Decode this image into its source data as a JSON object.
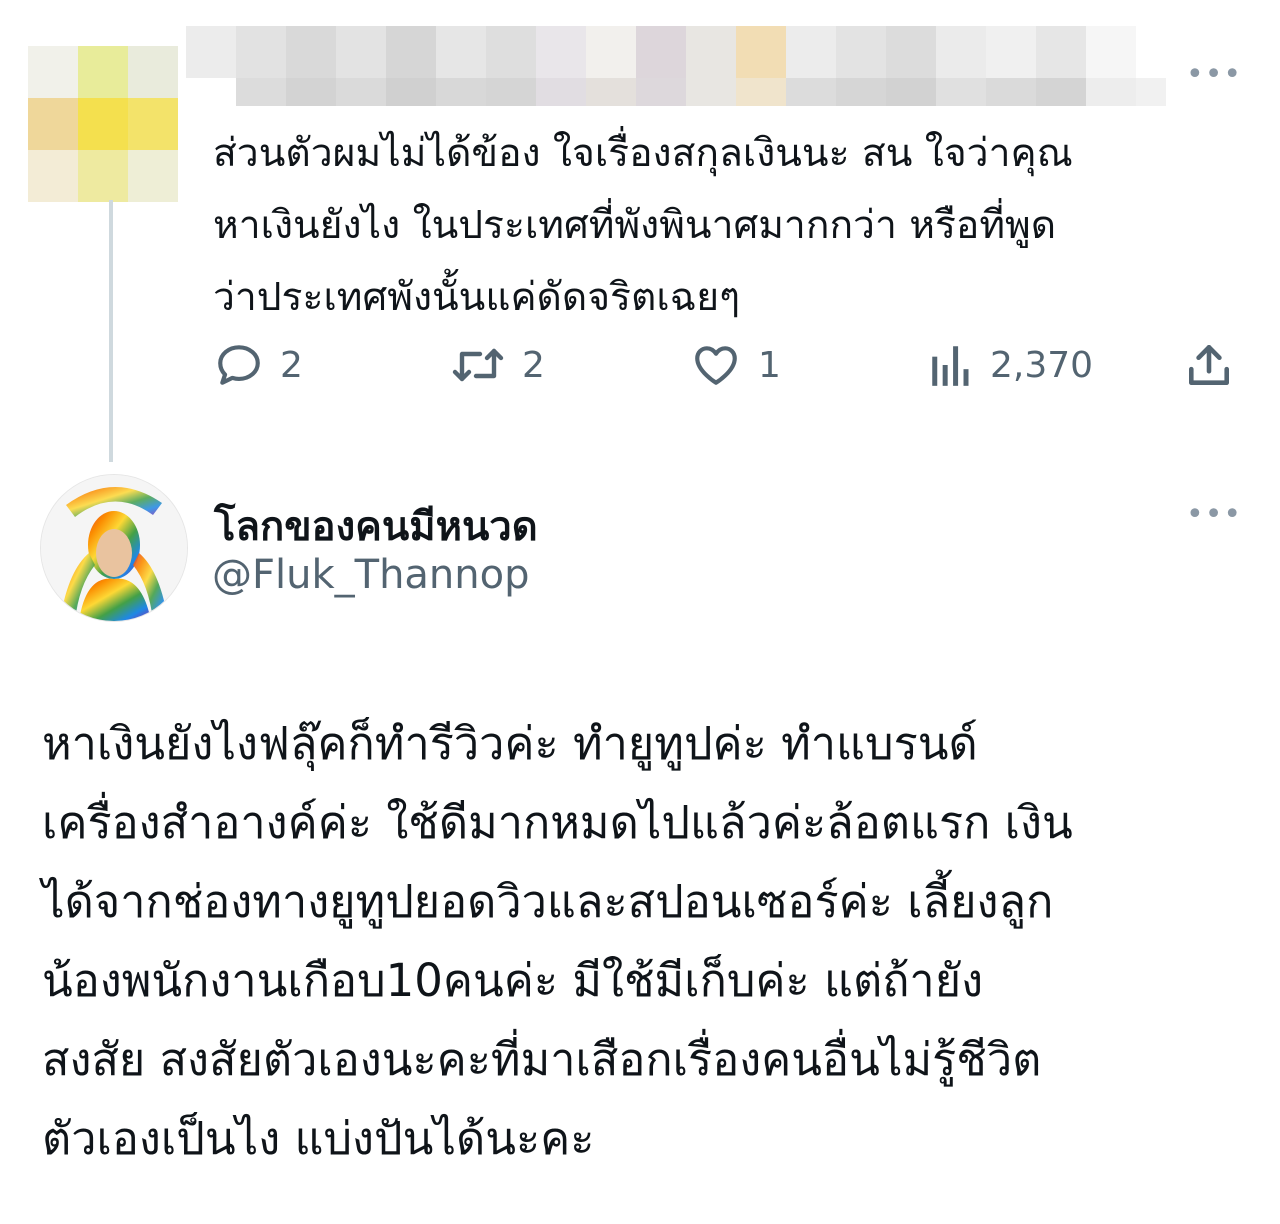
{
  "parent_tweet": {
    "text_lines": [
      "ส่วนตัวผมไม่ได้ข้อง ใจเรื่องสกุลเงินนะ สน ใจว่าคุณ",
      "หาเงินยังไง ในประเทศที่พังพินาศมากกว่า หรือที่พูด",
      "ว่าประเทศพังนั้นแค่ดัดจริตเฉยๆ"
    ],
    "actions": {
      "replies": "2",
      "retweets": "2",
      "likes": "1",
      "views": "2,370"
    }
  },
  "reply_tweet": {
    "display_name": "โลกของคนมีหนวด",
    "handle": "@Fluk_Thannop",
    "text_lines": [
      "หาเงินยังไงฟลุ๊คก็ทำรีวิวค่ะ ทำยูทูปค่ะ ทำแบรนด์",
      "เครื่องสำอางค์ค่ะ ใช้ดีมากหมดไปแล้วค่ะล้อตแรก เงิน",
      "ได้จากช่องทางยูทูปยอดวิวและสปอนเซอร์ค่ะ เลี้ยงลูก",
      "น้องพนักงานเกือบ10คนค่ะ มีใช้มีเก็บค่ะ แต่ถ้ายัง",
      "สงสัย สงสัยตัวเองนะคะที่มาเสือกเรื่องคนอื่นไม่รู้ชีวิต",
      "ตัวเองเป็นไง แบ่งปันได้นะคะ"
    ]
  },
  "icons": {
    "reply": "reply-icon",
    "retweet": "retweet-icon",
    "like": "heart-icon",
    "views": "views-icon",
    "share": "share-icon",
    "more": "more-icon"
  },
  "colors": {
    "text": "#0f1419",
    "muted": "#536471",
    "thread_line": "#cfd9de"
  }
}
